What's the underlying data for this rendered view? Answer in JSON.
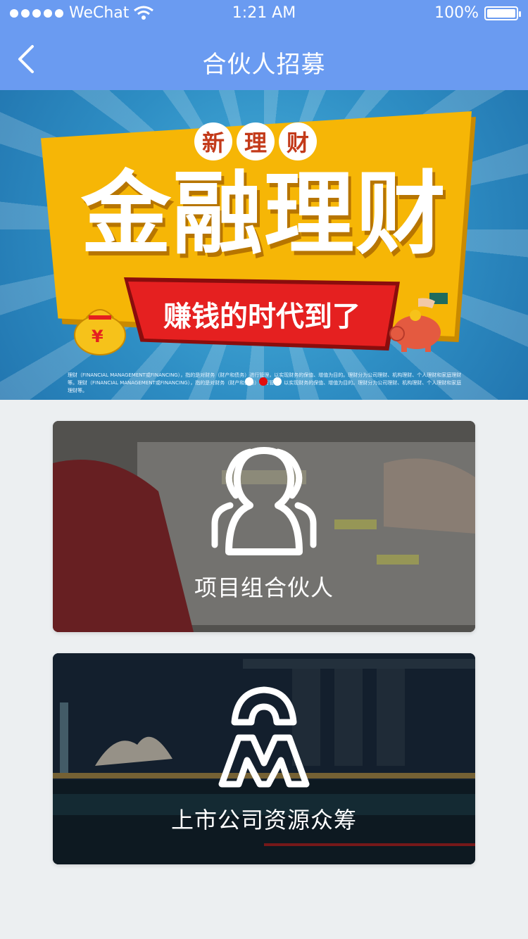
{
  "status_bar": {
    "carrier": "WeChat",
    "time": "1:21 AM",
    "battery": "100%"
  },
  "nav": {
    "title": "合伙人招募"
  },
  "banner": {
    "badges": [
      "新",
      "理",
      "财"
    ],
    "headline": "金融理财",
    "ribbon": "赚钱的时代到了",
    "fine_print": "理财（FINANCIAL MANAGEMENT或FINANCING），指的是对财务（财产和债务）进行管理，以实现财务的保值、增值为目的。理财分为公司理财、机构理财、个人理财和家庭理财等。理财（FINANCIAL MANAGEMENT或FINANCING），指的是对财务（财产和债务）进行管理，以实现财务的保值、增值为目的。理财分为公司理财、机构理财、个人理财和家庭理财等。",
    "carousel": {
      "count": 3,
      "active_index": 1
    },
    "colors": {
      "yellow": "#f6b606",
      "ribbon": "#e52020",
      "sky": "#2e8ec4"
    }
  },
  "cards": [
    {
      "label": "项目组合伙人",
      "icon": "partner-group-icon"
    },
    {
      "label": "上市公司资源众筹",
      "icon": "crowdfunding-people-icon"
    }
  ],
  "colors": {
    "header": "#6a9bf1",
    "page_bg": "#eceff1"
  }
}
